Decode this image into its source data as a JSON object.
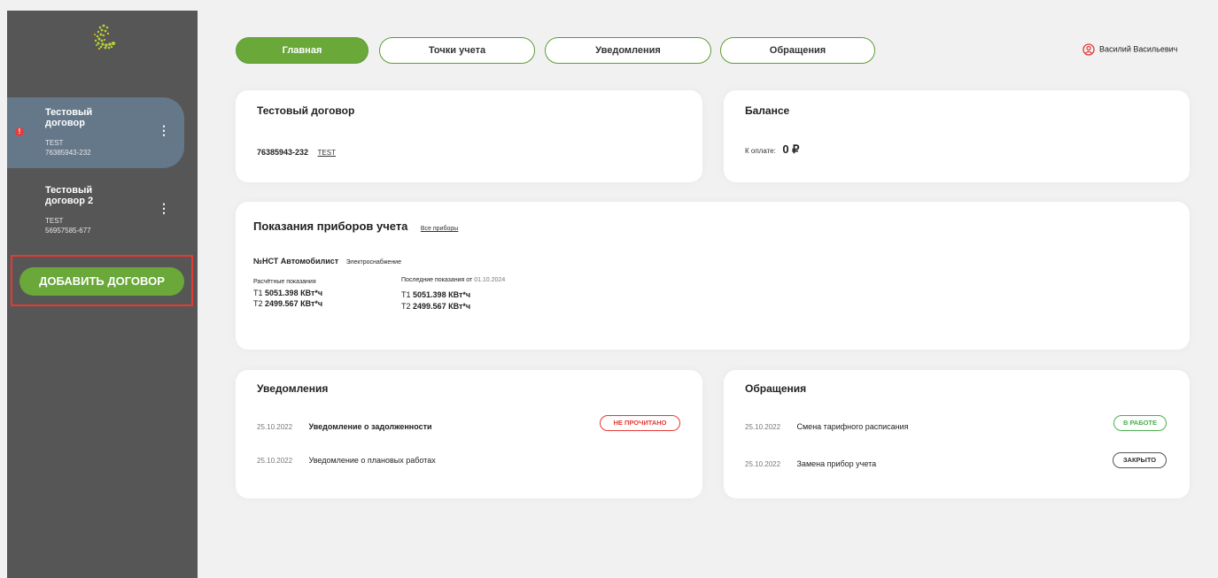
{
  "sidebar": {
    "contracts": [
      {
        "title": "Тестовый договор",
        "label": "TEST",
        "number": "76385943-232",
        "has_alert": true,
        "alert_mark": "!"
      },
      {
        "title": "Тестовый договор 2",
        "label": "TEST",
        "number": "56957585-677",
        "has_alert": false
      }
    ],
    "menu_glyph": "⋮",
    "add_button": "ДОБАВИТЬ ДОГОВОР"
  },
  "nav": {
    "tabs": [
      {
        "label": "Главная",
        "active": true
      },
      {
        "label": "Точки учета",
        "active": false
      },
      {
        "label": "Уведомления",
        "active": false
      },
      {
        "label": "Обращения",
        "active": false
      }
    ],
    "user_name": "Василий Васильевич"
  },
  "contract_card": {
    "title": "Тестовый договор",
    "number": "76385943-232",
    "label_link": "TEST"
  },
  "balance_card": {
    "title": "Балансе",
    "to_pay_label": "К оплате:",
    "amount": "0 ₽"
  },
  "meters_card": {
    "title": "Показания приборов учета",
    "all_link": "Все приборы",
    "meter_name": "№НСТ Автомобилист",
    "meter_type": "Электроснабжение",
    "calc_label": "Расчётные показания",
    "calc": [
      {
        "tariff": "Т1",
        "value": "5051.398 КВт*ч"
      },
      {
        "tariff": "Т2",
        "value": "2499.567 КВт*ч"
      }
    ],
    "last_label": "Последние показания от",
    "last_date": "01.10.2024",
    "last": [
      {
        "tariff": "Т1",
        "value": "5051.398 КВт*ч"
      },
      {
        "tariff": "Т2",
        "value": "2499.567 КВт*ч"
      }
    ]
  },
  "notifications_card": {
    "title": "Уведомления",
    "items": [
      {
        "date": "25.10.2022",
        "text": "Уведомление о задолженности",
        "status": "НЕ ПРОЧИТАНО"
      },
      {
        "date": "25.10.2022",
        "text": "Уведомление о плановых работах",
        "status": ""
      }
    ]
  },
  "requests_card": {
    "title": "Обращения",
    "items": [
      {
        "date": "25.10.2022",
        "text": "Смена тарифного расписания",
        "status": "В РАБОТЕ"
      },
      {
        "date": "25.10.2022",
        "text": "Замена прибор учета",
        "status": "ЗАКРЫТО"
      }
    ]
  },
  "colors": {
    "accent_green": "#6aa83a",
    "sidebar_bg": "#565656",
    "active_contract_bg": "#65788a",
    "alert_red": "#e43c3c"
  }
}
